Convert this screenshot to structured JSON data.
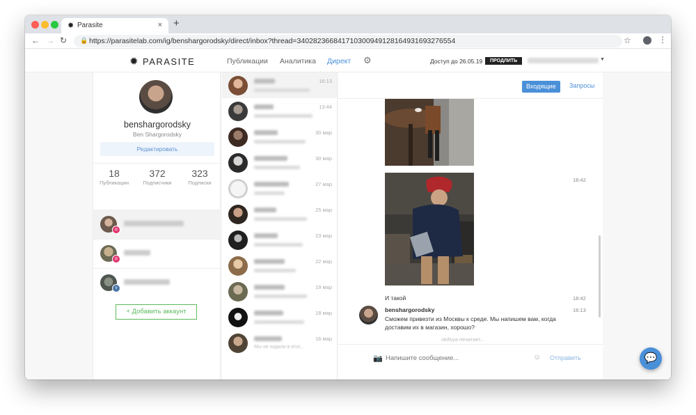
{
  "browser": {
    "tab_title": "Parasite",
    "tab_close": "×",
    "new_tab": "+",
    "url": "https://parasitelab.com/ig/benshargorodsky/direct/inbox?thread=340282366841710300949128164931693276554",
    "traffic_lights": [
      "#ff5f57",
      "#febc2e",
      "#28c840"
    ]
  },
  "header": {
    "logo": "PARASITE",
    "nav": [
      "Публикации",
      "Аналитика",
      "Директ"
    ],
    "active_nav": "Директ",
    "access_text": "Доступ до 26.05.19",
    "extend_button": "ПРОДЛИТЬ"
  },
  "profile": {
    "username": "benshargorodsky",
    "full_name": "Ben Shargorodsky",
    "edit_button": "Редактировать",
    "stats": [
      {
        "value": "18",
        "label": "Публикации"
      },
      {
        "value": "372",
        "label": "Подписчики"
      },
      {
        "value": "323",
        "label": "Подписки"
      }
    ],
    "accounts": [
      {
        "type": "instagram",
        "badge_color": "#e1306c"
      },
      {
        "type": "instagram",
        "badge_color": "#e1306c"
      },
      {
        "type": "vk",
        "badge_color": "#4a76a8"
      }
    ],
    "add_account_button": "+ Добавить аккаунт"
  },
  "threads": [
    {
      "date": "16:13",
      "preview": ""
    },
    {
      "date": "13:44",
      "preview": ""
    },
    {
      "date": "30 мар",
      "preview": ""
    },
    {
      "date": "30 мар",
      "preview": ""
    },
    {
      "date": "27 мар",
      "preview": ""
    },
    {
      "date": "25 мар",
      "preview": ""
    },
    {
      "date": "23 мар",
      "preview": ""
    },
    {
      "date": "22 мар",
      "preview": ""
    },
    {
      "date": "19 мар",
      "preview": ""
    },
    {
      "date": "18 мар",
      "preview": ""
    },
    {
      "date": "16 мар",
      "preview": "Мы не ходили в итог..."
    }
  ],
  "conversation": {
    "inbox_tab": "Входящие",
    "requests_tab": "Запросы",
    "photo_time": "18:42",
    "text_message": "И такой",
    "text_time": "18:42",
    "sender": "benshargorodsky",
    "sender_time": "16:13",
    "sender_message": "Сможем привезти из Москвы к среде. Мы напишем вам, когда доставим их в магазин, хорошо?",
    "typing": "okifoya печатает...",
    "input_placeholder": "Напишите сообщение...",
    "send_button": "Отправить"
  }
}
